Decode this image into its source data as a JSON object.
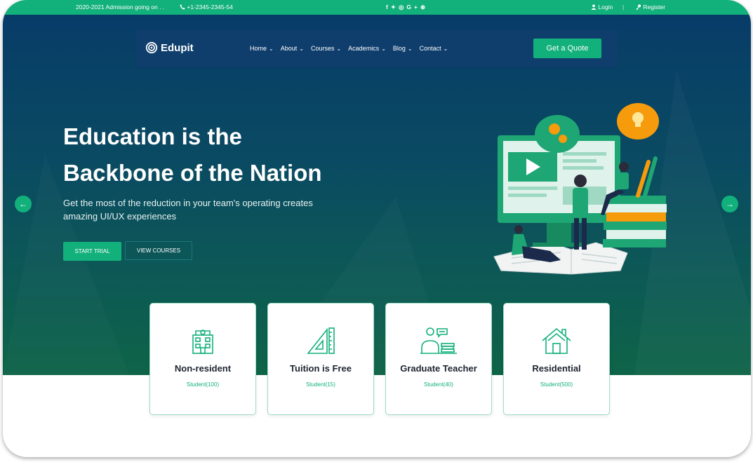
{
  "topbar": {
    "admission": "2020-2021 Admission going on . .",
    "phone": "+1-2345-2345-54",
    "social_icons": [
      "facebook-icon",
      "twitter-icon",
      "instagram-icon",
      "google-plus-icon",
      "dribbble-icon"
    ],
    "login": "Login",
    "register": "Register"
  },
  "nav": {
    "brand": "Edupit",
    "items": [
      {
        "label": "Home"
      },
      {
        "label": "About"
      },
      {
        "label": "Courses"
      },
      {
        "label": "Academics"
      },
      {
        "label": "Blog"
      },
      {
        "label": "Contact"
      }
    ],
    "cta": "Get a Quote"
  },
  "hero": {
    "title_line1": "Education is the",
    "title_line2": "Backbone of the Nation",
    "subtitle": "Get the most of the reduction in your team's operating creates amazing UI/UX experiences",
    "btn_start": "START TRIAL",
    "btn_courses": "VIEW COURSES"
  },
  "features": [
    {
      "icon": "building-icon",
      "title": "Non-resident",
      "students": "Student(100)"
    },
    {
      "icon": "set-square-ruler-icon",
      "title": "Tuition is Free",
      "students": "Student(15)"
    },
    {
      "icon": "teacher-icon",
      "title": "Graduate Teacher",
      "students": "Student(40)"
    },
    {
      "icon": "house-icon",
      "title": "Residential",
      "students": "Student(500)"
    }
  ],
  "colors": {
    "accent": "#12b07a",
    "hero_top": "#073c68",
    "hero_bottom": "#0e6447",
    "nav_bg": "#0f3e6c",
    "title_dark": "#1d2430"
  }
}
